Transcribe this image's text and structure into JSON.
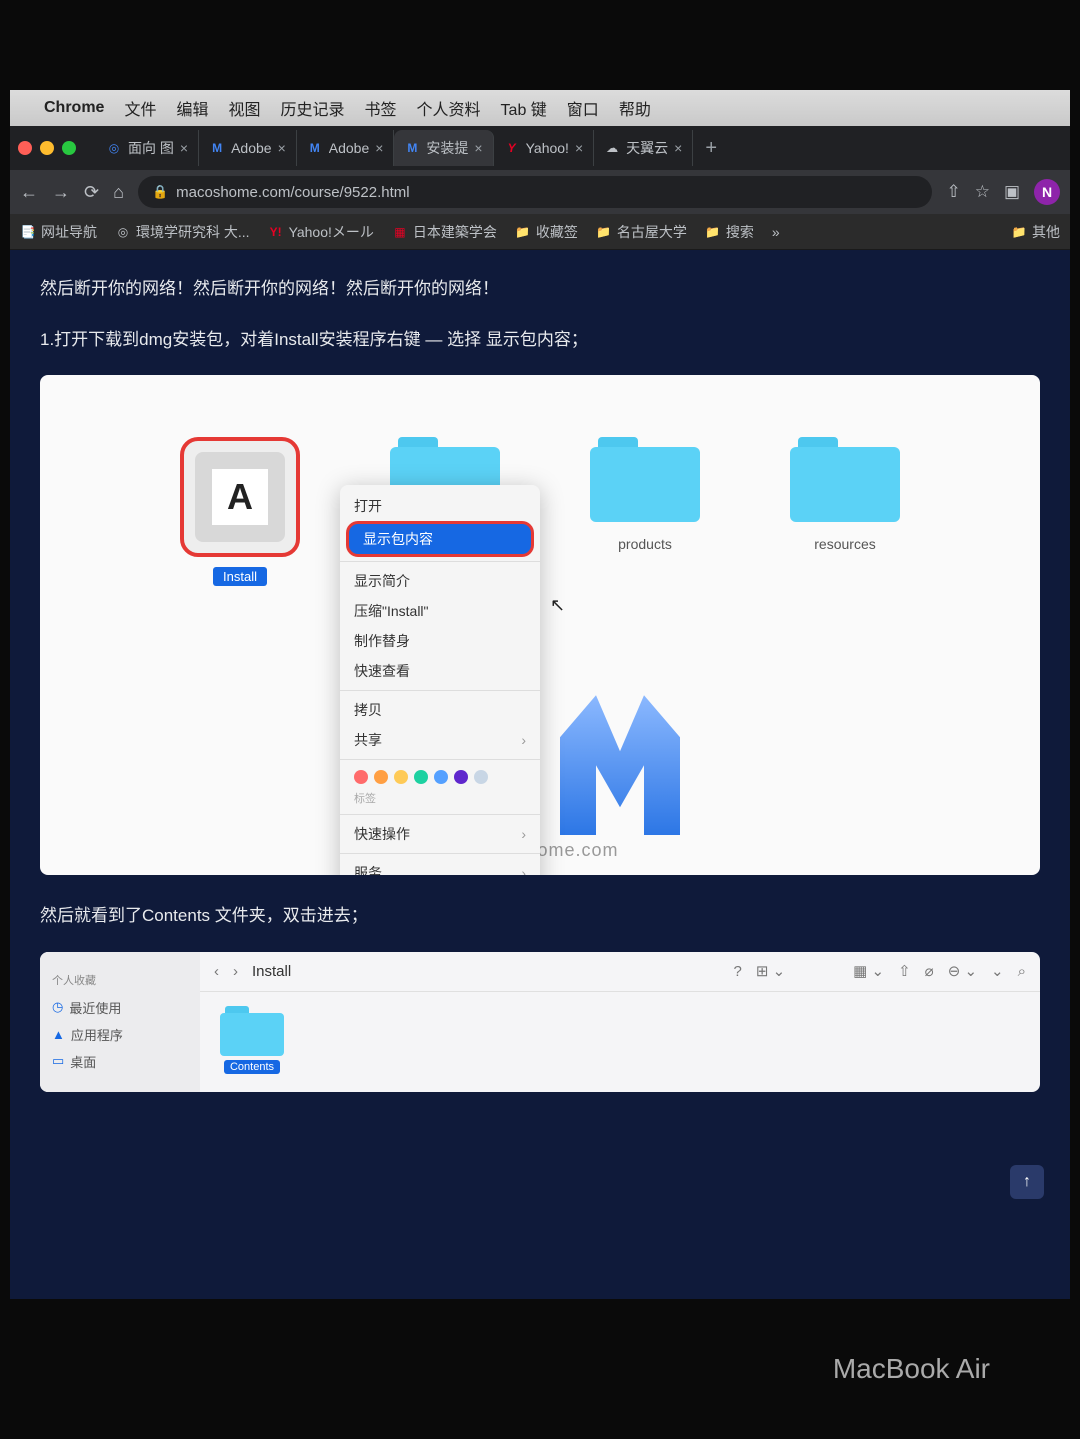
{
  "menubar": {
    "app": "Chrome",
    "items": [
      "文件",
      "编辑",
      "视图",
      "历史记录",
      "书签",
      "个人资料",
      "Tab 键",
      "窗口",
      "帮助"
    ]
  },
  "tabs": [
    {
      "icon": "◎",
      "iconColor": "#4285f4",
      "title": "面向 图"
    },
    {
      "icon": "M",
      "iconColor": "#4285f4",
      "title": "Adobe"
    },
    {
      "icon": "M",
      "iconColor": "#4285f4",
      "title": "Adobe"
    },
    {
      "icon": "M",
      "iconColor": "#4285f4",
      "title": "安装提",
      "active": true
    },
    {
      "icon": "Y",
      "iconColor": "#e60023",
      "title": "Yahoo!"
    },
    {
      "icon": "☁",
      "iconColor": "#fff",
      "title": "天翼云"
    }
  ],
  "omnibox": {
    "url": "macoshome.com/course/9522.html"
  },
  "profile": {
    "letter": "N"
  },
  "bookmarks": [
    {
      "icon": "📑",
      "label": "网址导航"
    },
    {
      "icon": "◎",
      "label": "環境学研究科 大..."
    },
    {
      "icon": "Y!",
      "label": "Yahoo!メール"
    },
    {
      "icon": "▦",
      "label": "日本建築学会"
    },
    {
      "icon": "📁",
      "label": "收藏签"
    },
    {
      "icon": "📁",
      "label": "名古屋大学"
    },
    {
      "icon": "📁",
      "label": "搜索"
    }
  ],
  "bookmarkOverflow": "其他",
  "article": {
    "warning": "然后断开你的网络！然后断开你的网络！然后断开你的网络！",
    "step1": "1.打开下载到dmg安装包，对着Install安装程序右键 — 选择 显示包内容；",
    "step2": "然后就看到了Contents 文件夹，双击进去；"
  },
  "figure1": {
    "installLabel": "Install",
    "folders": [
      "",
      "products",
      "resources"
    ],
    "watermark": "macOShome.com"
  },
  "contextMenu": {
    "open": "打开",
    "showContents": "显示包内容",
    "getInfo": "显示简介",
    "compress": "压缩\"Install\"",
    "alias": "制作替身",
    "quicklook": "快速查看",
    "copy": "拷贝",
    "share": "共享",
    "tags": "标签",
    "quickActions": "快速操作",
    "services": "服务",
    "tagColors": [
      "#ff6b6b",
      "#ff9f43",
      "#feca57",
      "#1dd1a1",
      "#54a0ff",
      "#5f27cd",
      "#c8d6e5"
    ]
  },
  "finder": {
    "title": "Install",
    "sidebarHeader": "个人收藏",
    "sidebar": [
      {
        "icon": "◷",
        "label": "最近使用"
      },
      {
        "icon": "▲",
        "label": "应用程序"
      },
      {
        "icon": "▭",
        "label": "桌面"
      }
    ],
    "contentsLabel": "Contents"
  },
  "brand": "MacBook Air"
}
